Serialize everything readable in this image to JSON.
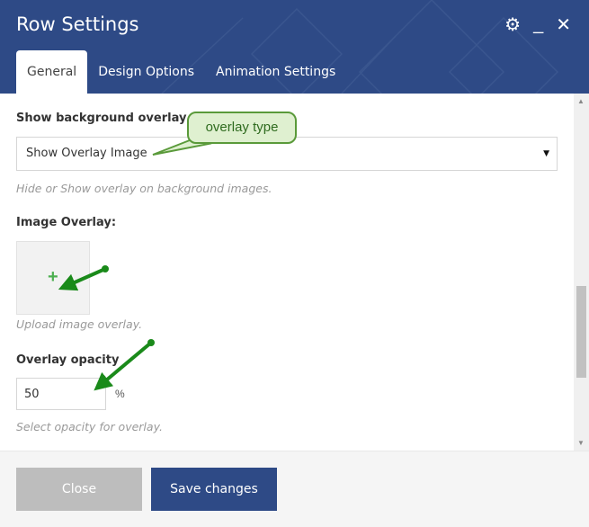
{
  "window": {
    "title": "Row Settings"
  },
  "header_icons": {
    "settings": "gear-icon",
    "minimize": "minimize-icon",
    "close": "close-icon"
  },
  "tabs": [
    {
      "label": "General",
      "active": true
    },
    {
      "label": "Design Options",
      "active": false
    },
    {
      "label": "Animation Settings",
      "active": false
    }
  ],
  "fields": {
    "bg_overlay": {
      "label": "Show background overlay",
      "value": "Show Overlay Image",
      "hint": "Hide or Show overlay on background images."
    },
    "image_overlay": {
      "label": "Image Overlay:",
      "add_icon": "plus-icon",
      "hint": "Upload image overlay."
    },
    "opacity": {
      "label": "Overlay opacity",
      "value": "50",
      "unit": "%",
      "hint": "Select opacity for overlay."
    }
  },
  "annotation": {
    "text": "overlay type"
  },
  "footer": {
    "close_label": "Close",
    "save_label": "Save changes"
  },
  "colors": {
    "brand": "#2e4a86",
    "annotation_green": "#1a8a1a",
    "plus_green": "#4caf50"
  }
}
